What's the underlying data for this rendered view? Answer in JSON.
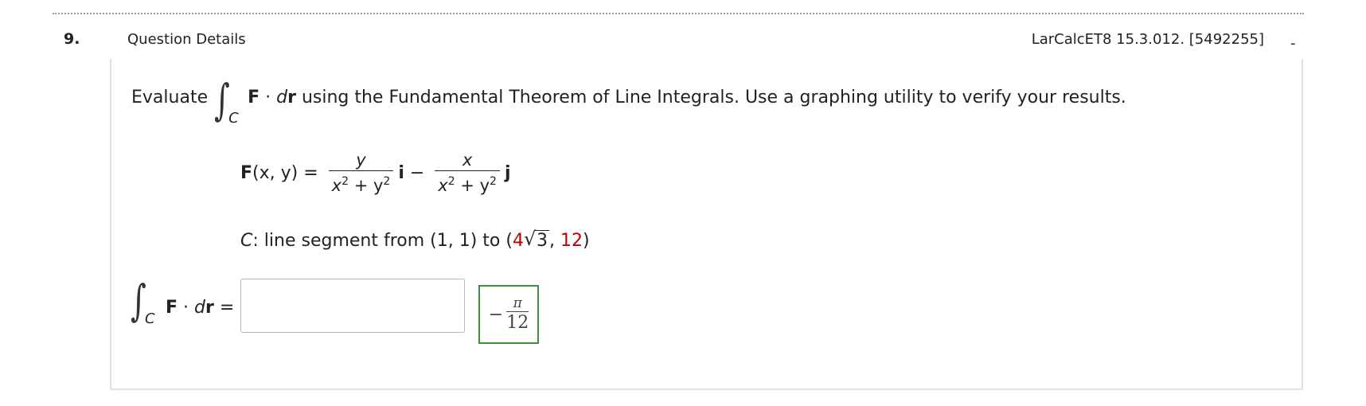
{
  "header": {
    "question_number": "9.",
    "details_label": "Question Details",
    "reference": "LarCalcET8 15.3.012. [5492255]",
    "collapse_glyph": "-"
  },
  "problem": {
    "evaluate_word": "Evaluate",
    "integral_symbol": "∫",
    "integral_subscript": "C",
    "integrand_F": "F",
    "dot": " · ",
    "integrand_d": "d",
    "integrand_r": "r",
    "instruction": " using the Fundamental Theorem of Line Integrals. Use a graphing utility to verify your results."
  },
  "vector_field": {
    "lhs_F": "F",
    "lhs_args": "(x, y) = ",
    "frac1_num": "y",
    "frac1_den": "x",
    "frac1_den_mid": " + y",
    "exp": "2",
    "unit_i": "i",
    "minus": " − ",
    "frac2_num": "x",
    "frac2_den": "x",
    "frac2_den_mid": " + y",
    "unit_j": "j"
  },
  "curve": {
    "label": "C",
    "text": ": line segment from (1, 1) to (",
    "coef": "4",
    "sqrt_symbol": "√",
    "radicand": "3",
    "comma": ", ",
    "y_value": "12",
    "close": ")"
  },
  "answer_row": {
    "integral_symbol": "∫",
    "integral_subscript": "C",
    "F": "F",
    "dot": " · ",
    "d": "d",
    "r": "r",
    "equals": " =",
    "input_value": "",
    "correct_answer": {
      "sign": "−",
      "numerator": "π",
      "denominator": "12"
    }
  },
  "colors": {
    "highlight_red": "#c00000",
    "correct_border": "#3f8f3f",
    "panel_border": "#e3e3e3"
  }
}
